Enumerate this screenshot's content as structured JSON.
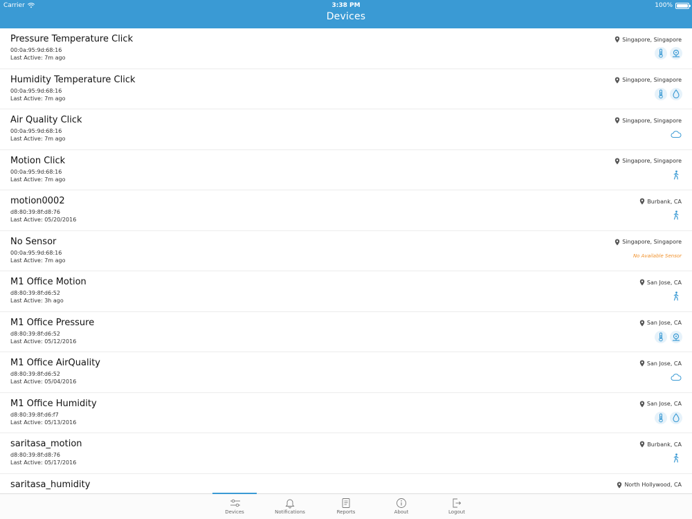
{
  "status_bar": {
    "carrier": "Carrier",
    "time": "3:38 PM",
    "battery": "100%"
  },
  "nav": {
    "title": "Devices"
  },
  "colors": {
    "accent": "#3a9ad4",
    "warning": "#f0902a"
  },
  "devices": [
    {
      "name": "Pressure Temperature Click",
      "mac": "00:0a:95:9d:68:16",
      "last_active": "Last Active: 7m ago",
      "location": "Singapore, Singapore",
      "sensors": [
        "thermometer-icon",
        "pressure-icon"
      ]
    },
    {
      "name": "Humidity Temperature Click",
      "mac": "00:0a:95:9d:68:16",
      "last_active": "Last Active: 7m ago",
      "location": "Singapore, Singapore",
      "sensors": [
        "thermometer-icon",
        "droplet-icon"
      ]
    },
    {
      "name": "Air Quality Click",
      "mac": "00:0a:95:9d:68:16",
      "last_active": "Last Active: 7m ago",
      "location": "Singapore, Singapore",
      "sensors": [
        "cloud-icon"
      ]
    },
    {
      "name": "Motion Click",
      "mac": "00:0a:95:9d:68:16",
      "last_active": "Last Active: 7m ago",
      "location": "Singapore, Singapore",
      "sensors": [
        "walking-person-icon"
      ]
    },
    {
      "name": " motion0002",
      "mac": "d8:80:39:8f:d8:76",
      "last_active": "Last Active: 05/20/2016",
      "location": "Burbank, CA",
      "sensors": [
        "walking-person-icon"
      ]
    },
    {
      "name": "No Sensor",
      "mac": "00:0a:95:9d:68:16",
      "last_active": "Last Active: 7m ago",
      "location": "Singapore, Singapore",
      "sensors": [],
      "no_sensor_text": "No Available Sensor"
    },
    {
      "name": "M1 Office Motion",
      "mac": "d8:80:39:8f:d6:52",
      "last_active": "Last Active: 3h ago",
      "location": "San Jose, CA",
      "sensors": [
        "walking-person-icon"
      ]
    },
    {
      "name": "M1 Office Pressure",
      "mac": "d8:80:39:8f:d6:52",
      "last_active": "Last Active: 05/12/2016",
      "location": "San Jose, CA",
      "sensors": [
        "thermometer-icon",
        "pressure-icon"
      ]
    },
    {
      "name": "M1 Office AirQuality",
      "mac": "d8:80:39:8f:d6:52",
      "last_active": "Last Active: 05/04/2016",
      "location": "San Jose, CA",
      "sensors": [
        "cloud-icon"
      ]
    },
    {
      "name": "M1 Office Humidity",
      "mac": "d8:80:39:8f:d6:f7",
      "last_active": "Last Active: 05/13/2016",
      "location": "San Jose, CA",
      "sensors": [
        "thermometer-icon",
        "droplet-icon"
      ]
    },
    {
      "name": "saritasa_motion",
      "mac": "d8:80:39:8f:d8:76",
      "last_active": "Last Active: 05/17/2016",
      "location": "Burbank, CA",
      "sensors": [
        "walking-person-icon"
      ]
    },
    {
      "name": "saritasa_humidity",
      "mac": "",
      "last_active": "",
      "location": "North Hollywood, CA",
      "sensors": []
    }
  ],
  "tabs": [
    {
      "label": "Devices",
      "icon": "devices-icon",
      "active": true
    },
    {
      "label": "Notifications",
      "icon": "bell-icon",
      "active": false
    },
    {
      "label": "Reports",
      "icon": "report-icon",
      "active": false
    },
    {
      "label": "About",
      "icon": "info-icon",
      "active": false
    },
    {
      "label": "Logout",
      "icon": "logout-icon",
      "active": false
    }
  ]
}
